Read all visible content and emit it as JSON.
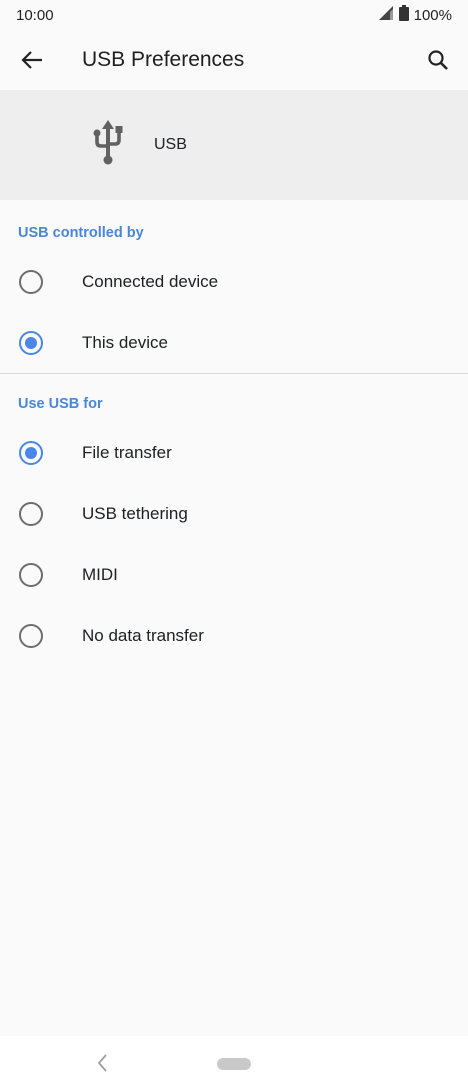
{
  "status_bar": {
    "time": "10:00",
    "battery": "100%",
    "icons": [
      "signal-icon",
      "battery-icon"
    ]
  },
  "app_bar": {
    "title": "USB Preferences",
    "icons": [
      "back-arrow-icon",
      "search-icon"
    ]
  },
  "header": {
    "icon": "usb-icon",
    "label": "USB"
  },
  "sections": [
    {
      "title": "USB controlled by",
      "options": [
        {
          "label": "Connected device",
          "checked": false
        },
        {
          "label": "This device",
          "checked": true
        }
      ]
    },
    {
      "title": "Use USB for",
      "options": [
        {
          "label": "File transfer",
          "checked": true
        },
        {
          "label": "USB tethering",
          "checked": false
        },
        {
          "label": "MIDI",
          "checked": false
        },
        {
          "label": "No data transfer",
          "checked": false
        }
      ]
    }
  ],
  "nav_bar": {
    "icons": [
      "nav-back-icon",
      "home-pill"
    ]
  },
  "colors": {
    "accent": "#4a86e8",
    "section_title": "#4a86d8",
    "header_bg": "#eeeeee",
    "page_bg": "#fafafa"
  }
}
